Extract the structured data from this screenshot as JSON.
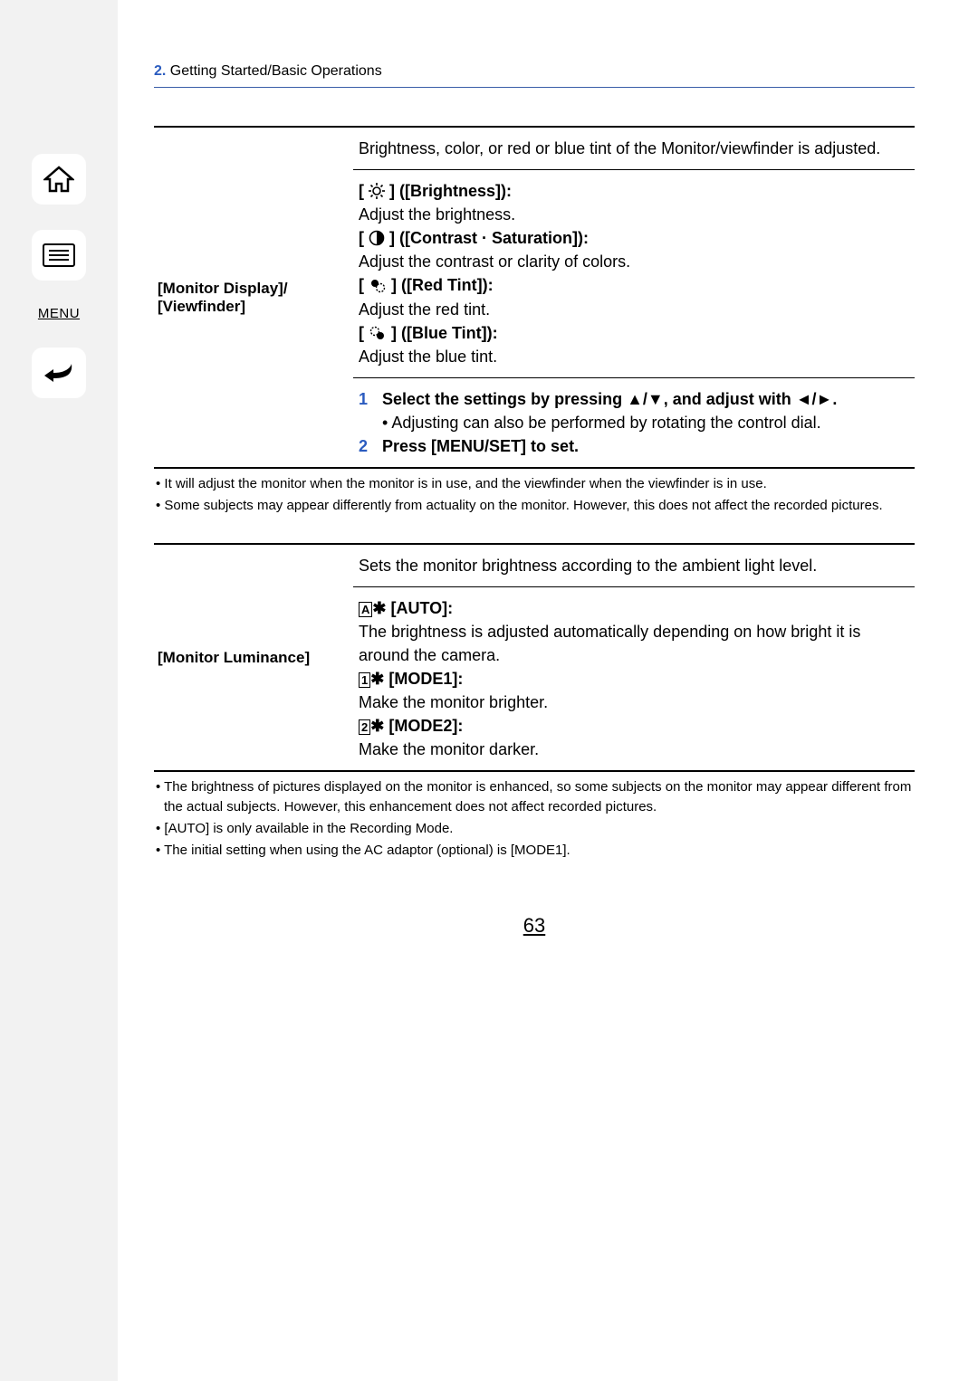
{
  "chapter": {
    "num": "2.",
    "title": " Getting Started/Basic Operations"
  },
  "sidebar": {
    "menu": "MENU"
  },
  "table1": {
    "label_line1": "[Monitor Display]/",
    "label_line2": "[Viewfinder]",
    "intro": "Brightness, color, or red or blue tint of the Monitor/viewfinder is adjusted.",
    "opt1_label": " ([Brightness]):",
    "opt1_text": "Adjust the brightness.",
    "opt2_label": " ([Contrast · Saturation]):",
    "opt2_text": "Adjust the contrast or clarity of colors.",
    "opt3_label": " ([Red Tint]):",
    "opt3_text": " Adjust the red tint.",
    "opt4_label": " ([Blue Tint]):",
    "opt4_text": " Adjust the blue tint.",
    "step1_num": "1",
    "step1": "Select the settings by pressing ▲/▼, and adjust with ◄/►.",
    "step1_sub": "• Adjusting can also be performed by rotating the control dial.",
    "step2_num": "2",
    "step2": "Press [MENU/SET] to set."
  },
  "notes1": {
    "n1": "• It will adjust the monitor when the monitor is in use, and the viewfinder when the viewfinder is in use.",
    "n2": "• Some subjects may appear differently from actuality on the monitor. However, this does not affect the recorded pictures."
  },
  "table2": {
    "label": "[Monitor Luminance]",
    "intro": "Sets the monitor brightness according to the ambient light level.",
    "auto_hdr": " [AUTO]:",
    "auto_txt": "The brightness is adjusted automatically depending on how bright it is around the camera.",
    "m1_hdr": " [MODE1]:",
    "m1_txt": "Make the monitor brighter.",
    "m2_hdr": " [MODE2]:",
    "m2_txt": "Make the monitor darker."
  },
  "notes2": {
    "n1": "• The brightness of pictures displayed on the monitor is enhanced, so some subjects on the monitor may appear different from the actual subjects. However, this enhancement does not affect recorded pictures.",
    "n2": "• [AUTO] is only available in the Recording Mode.",
    "n3": "• The initial setting when using the AC adaptor (optional) is [MODE1]."
  },
  "page": "63"
}
